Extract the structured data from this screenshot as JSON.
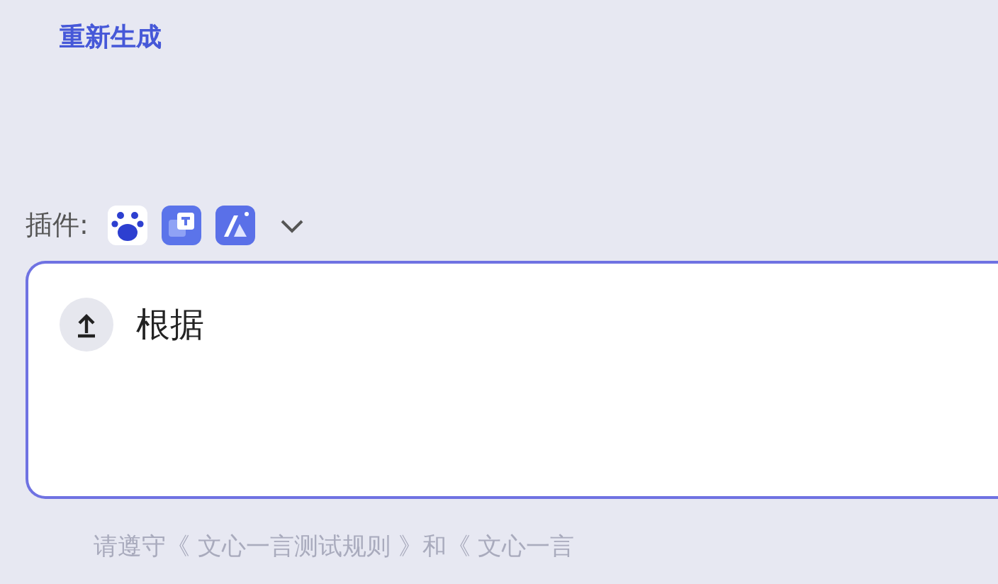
{
  "regenerate_link": "重新生成",
  "plugins": {
    "label": "插件:",
    "items": [
      {
        "kind": "paw"
      },
      {
        "kind": "t"
      },
      {
        "kind": "a"
      }
    ]
  },
  "input": {
    "value": "根据"
  },
  "footer_note": "请遵守《 文心一言测试规则 》和《 文心一言"
}
